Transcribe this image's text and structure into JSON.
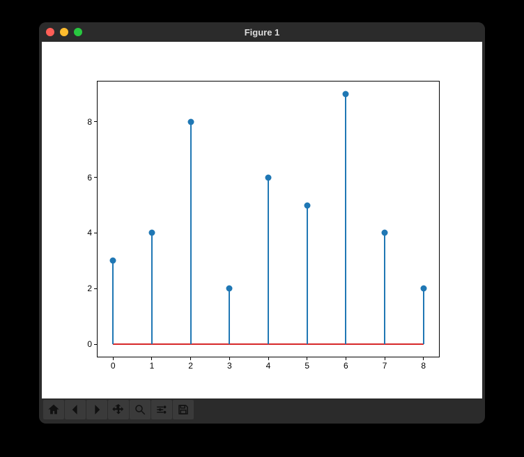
{
  "window": {
    "title": "Figure 1"
  },
  "toolbar": {
    "items": [
      {
        "name": "home-icon"
      },
      {
        "name": "back-icon"
      },
      {
        "name": "forward-icon"
      },
      {
        "name": "pan-icon"
      },
      {
        "name": "zoom-icon"
      },
      {
        "name": "subplots-icon"
      },
      {
        "name": "save-icon"
      }
    ]
  },
  "chart_data": {
    "type": "stem",
    "x": [
      0,
      1,
      2,
      3,
      4,
      5,
      6,
      7,
      8
    ],
    "values": [
      3,
      4,
      8,
      2,
      6,
      5,
      9,
      4,
      2
    ],
    "baseline": 0,
    "xlim": [
      -0.4,
      8.4
    ],
    "ylim": [
      -0.45,
      9.45
    ],
    "x_ticks": [
      0,
      1,
      2,
      3,
      4,
      5,
      6,
      7,
      8
    ],
    "y_ticks": [
      0,
      2,
      4,
      6,
      8
    ],
    "stem_color": "#1f77b4",
    "baseline_color": "#d62728",
    "title": "",
    "xlabel": "",
    "ylabel": ""
  }
}
